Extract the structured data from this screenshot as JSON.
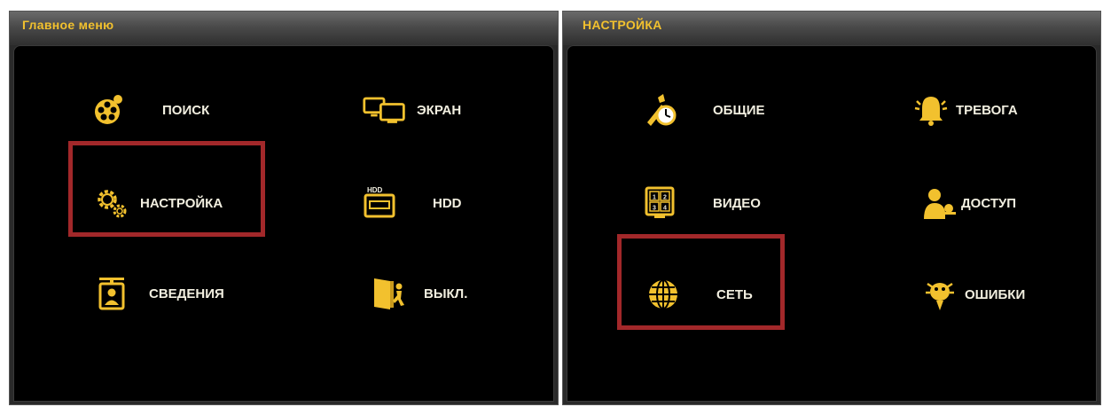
{
  "colors": {
    "accent": "#f2c12e",
    "highlight": "#a2282a",
    "text": "#f2efe0"
  },
  "main_menu": {
    "title": "Главное меню",
    "items": [
      {
        "label": "ПОИСК",
        "icon": "film-reel-icon"
      },
      {
        "label": "ЭКРАН",
        "icon": "monitors-icon"
      },
      {
        "label": "НАСТРОЙКА",
        "icon": "gears-icon",
        "selected": true
      },
      {
        "label": "HDD",
        "icon": "hdd-icon"
      },
      {
        "label": "СВЕДЕНИЯ",
        "icon": "info-card-icon"
      },
      {
        "label": "ВЫКЛ.",
        "icon": "exit-door-icon"
      }
    ]
  },
  "settings_menu": {
    "title": "НАСТРОЙКА",
    "items": [
      {
        "label": "ОБЩИЕ",
        "icon": "wrench-clock-icon"
      },
      {
        "label": "ТРЕВОГА",
        "icon": "alarm-bell-icon"
      },
      {
        "label": "ВИДЕО",
        "icon": "video-grid-icon",
        "grid": [
          "1",
          "2",
          "3",
          "4"
        ]
      },
      {
        "label": "ДОСТУП",
        "icon": "user-key-icon"
      },
      {
        "label": "СЕТЬ",
        "icon": "globe-icon",
        "selected": true
      },
      {
        "label": "ОШИБКИ",
        "icon": "bug-icon"
      }
    ]
  }
}
